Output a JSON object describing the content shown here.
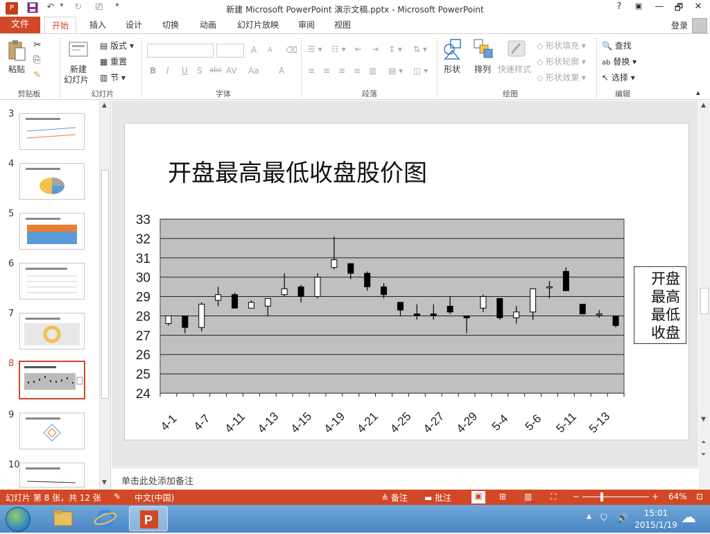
{
  "window": {
    "title": "新建 Microsoft PowerPoint 演示文稿.pptx - Microsoft PowerPoint",
    "help": "?",
    "minimize": "—",
    "restore": "🗗",
    "close": "✕"
  },
  "tabs": {
    "file": "文件",
    "items": [
      "开始",
      "插入",
      "设计",
      "切换",
      "动画",
      "幻灯片放映",
      "审阅",
      "视图"
    ],
    "active": "开始",
    "login": "登录"
  },
  "ribbon": {
    "clipboard": {
      "paste": "粘贴",
      "label": "剪贴板"
    },
    "slides": {
      "new_line1": "新建",
      "new_line2": "幻灯片",
      "layout": "版式",
      "reset": "重置",
      "section": "节",
      "label": "幻灯片"
    },
    "font": {
      "label": "字体",
      "bold": "B",
      "italic": "I",
      "underline": "U",
      "shadow": "S",
      "strike": "abc",
      "spacing": "AV",
      "case": "Aa",
      "color": "A",
      "grow": "A",
      "shrink": "A"
    },
    "paragraph": {
      "label": "段落"
    },
    "drawing": {
      "shapes": "形状",
      "arrange": "排列",
      "quick_styles": "快速样式",
      "fill": "形状填充",
      "outline": "形状轮廓",
      "effects": "形状效果",
      "label": "绘图"
    },
    "editing": {
      "find": "查找",
      "replace": "替换",
      "select": "选择",
      "label": "编辑"
    }
  },
  "slides_panel": {
    "numbers": [
      "3",
      "4",
      "5",
      "6",
      "7",
      "8",
      "9",
      "10"
    ],
    "selected": "8"
  },
  "slide": {
    "title": "开盘最高最低收盘股价图",
    "legend": [
      "开盘",
      "最高",
      "最低",
      "收盘"
    ]
  },
  "chart_data": {
    "type": "candlestick",
    "title": "开盘最高最低收盘股价图",
    "ylim": [
      24,
      33
    ],
    "yticks": [
      "24",
      "25",
      "26",
      "27",
      "28",
      "29",
      "30",
      "31",
      "32",
      "33"
    ],
    "x_tick_labels": [
      "4-1",
      "4-7",
      "4-11",
      "4-13",
      "4-15",
      "4-19",
      "4-21",
      "4-25",
      "4-27",
      "4-29",
      "5-4",
      "5-6",
      "5-11",
      "5-13"
    ],
    "legend": [
      "开盘",
      "最高",
      "最低",
      "收盘"
    ],
    "grid": true,
    "legend_position": "right",
    "candles": [
      {
        "open": 27.6,
        "high": 28.0,
        "low": 27.5,
        "close": 28.0
      },
      {
        "open": 28.0,
        "high": 28.0,
        "low": 27.1,
        "close": 27.4
      },
      {
        "open": 27.4,
        "high": 28.7,
        "low": 27.2,
        "close": 28.6
      },
      {
        "open": 28.8,
        "high": 29.5,
        "low": 28.5,
        "close": 29.1
      },
      {
        "open": 29.1,
        "high": 29.2,
        "low": 28.4,
        "close": 28.4
      },
      {
        "open": 28.4,
        "high": 28.8,
        "low": 28.4,
        "close": 28.7
      },
      {
        "open": 28.5,
        "high": 28.9,
        "low": 28.0,
        "close": 28.9
      },
      {
        "open": 29.1,
        "high": 30.2,
        "low": 29.0,
        "close": 29.4
      },
      {
        "open": 29.5,
        "high": 29.6,
        "low": 28.7,
        "close": 29.0
      },
      {
        "open": 29.0,
        "high": 30.2,
        "low": 28.9,
        "close": 30.0
      },
      {
        "open": 30.5,
        "high": 32.1,
        "low": 30.4,
        "close": 30.9
      },
      {
        "open": 30.7,
        "high": 30.7,
        "low": 29.9,
        "close": 30.2
      },
      {
        "open": 30.2,
        "high": 30.3,
        "low": 29.3,
        "close": 29.5
      },
      {
        "open": 29.5,
        "high": 29.7,
        "low": 28.9,
        "close": 29.1
      },
      {
        "open": 28.7,
        "high": 28.7,
        "low": 28.0,
        "close": 28.3
      },
      {
        "open": 28.1,
        "high": 28.6,
        "low": 27.8,
        "close": 28.0
      },
      {
        "open": 28.1,
        "high": 28.6,
        "low": 27.8,
        "close": 28.0
      },
      {
        "open": 28.5,
        "high": 29.0,
        "low": 28.1,
        "close": 28.2
      },
      {
        "open": 28.0,
        "high": 28.0,
        "low": 27.1,
        "close": 27.9
      },
      {
        "open": 28.4,
        "high": 29.1,
        "low": 28.2,
        "close": 29.0
      },
      {
        "open": 28.9,
        "high": 28.9,
        "low": 27.8,
        "close": 27.9
      },
      {
        "open": 27.9,
        "high": 28.5,
        "low": 27.6,
        "close": 28.2
      },
      {
        "open": 28.2,
        "high": 29.4,
        "low": 27.8,
        "close": 29.4
      },
      {
        "open": 29.5,
        "high": 29.8,
        "low": 28.9,
        "close": 29.5
      },
      {
        "open": 30.3,
        "high": 30.5,
        "low": 29.3,
        "close": 29.3
      },
      {
        "open": 28.6,
        "high": 28.6,
        "low": 28.1,
        "close": 28.1
      },
      {
        "open": 28.1,
        "high": 28.3,
        "low": 27.9,
        "close": 28.1
      },
      {
        "open": 28.0,
        "high": 28.0,
        "low": 27.4,
        "close": 27.5
      }
    ]
  },
  "notes": {
    "placeholder": "单击此处添加备注"
  },
  "status": {
    "slide_info": "幻灯片 第 8 张，共 12 张",
    "language": "中文(中国)",
    "notes": "备注",
    "comments": "批注",
    "zoom": "64%"
  },
  "taskbar": {
    "time": "15:01",
    "date": "2015/1/19"
  }
}
